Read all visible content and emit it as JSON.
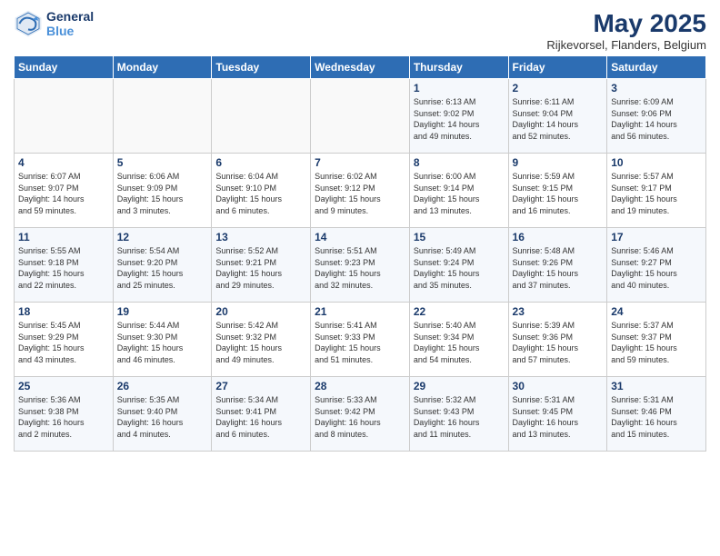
{
  "header": {
    "logo_line1": "General",
    "logo_line2": "Blue",
    "month_title": "May 2025",
    "subtitle": "Rijkevorsel, Flanders, Belgium"
  },
  "days_of_week": [
    "Sunday",
    "Monday",
    "Tuesday",
    "Wednesday",
    "Thursday",
    "Friday",
    "Saturday"
  ],
  "weeks": [
    [
      {
        "day": "",
        "info": ""
      },
      {
        "day": "",
        "info": ""
      },
      {
        "day": "",
        "info": ""
      },
      {
        "day": "",
        "info": ""
      },
      {
        "day": "1",
        "info": "Sunrise: 6:13 AM\nSunset: 9:02 PM\nDaylight: 14 hours\nand 49 minutes."
      },
      {
        "day": "2",
        "info": "Sunrise: 6:11 AM\nSunset: 9:04 PM\nDaylight: 14 hours\nand 52 minutes."
      },
      {
        "day": "3",
        "info": "Sunrise: 6:09 AM\nSunset: 9:06 PM\nDaylight: 14 hours\nand 56 minutes."
      }
    ],
    [
      {
        "day": "4",
        "info": "Sunrise: 6:07 AM\nSunset: 9:07 PM\nDaylight: 14 hours\nand 59 minutes."
      },
      {
        "day": "5",
        "info": "Sunrise: 6:06 AM\nSunset: 9:09 PM\nDaylight: 15 hours\nand 3 minutes."
      },
      {
        "day": "6",
        "info": "Sunrise: 6:04 AM\nSunset: 9:10 PM\nDaylight: 15 hours\nand 6 minutes."
      },
      {
        "day": "7",
        "info": "Sunrise: 6:02 AM\nSunset: 9:12 PM\nDaylight: 15 hours\nand 9 minutes."
      },
      {
        "day": "8",
        "info": "Sunrise: 6:00 AM\nSunset: 9:14 PM\nDaylight: 15 hours\nand 13 minutes."
      },
      {
        "day": "9",
        "info": "Sunrise: 5:59 AM\nSunset: 9:15 PM\nDaylight: 15 hours\nand 16 minutes."
      },
      {
        "day": "10",
        "info": "Sunrise: 5:57 AM\nSunset: 9:17 PM\nDaylight: 15 hours\nand 19 minutes."
      }
    ],
    [
      {
        "day": "11",
        "info": "Sunrise: 5:55 AM\nSunset: 9:18 PM\nDaylight: 15 hours\nand 22 minutes."
      },
      {
        "day": "12",
        "info": "Sunrise: 5:54 AM\nSunset: 9:20 PM\nDaylight: 15 hours\nand 25 minutes."
      },
      {
        "day": "13",
        "info": "Sunrise: 5:52 AM\nSunset: 9:21 PM\nDaylight: 15 hours\nand 29 minutes."
      },
      {
        "day": "14",
        "info": "Sunrise: 5:51 AM\nSunset: 9:23 PM\nDaylight: 15 hours\nand 32 minutes."
      },
      {
        "day": "15",
        "info": "Sunrise: 5:49 AM\nSunset: 9:24 PM\nDaylight: 15 hours\nand 35 minutes."
      },
      {
        "day": "16",
        "info": "Sunrise: 5:48 AM\nSunset: 9:26 PM\nDaylight: 15 hours\nand 37 minutes."
      },
      {
        "day": "17",
        "info": "Sunrise: 5:46 AM\nSunset: 9:27 PM\nDaylight: 15 hours\nand 40 minutes."
      }
    ],
    [
      {
        "day": "18",
        "info": "Sunrise: 5:45 AM\nSunset: 9:29 PM\nDaylight: 15 hours\nand 43 minutes."
      },
      {
        "day": "19",
        "info": "Sunrise: 5:44 AM\nSunset: 9:30 PM\nDaylight: 15 hours\nand 46 minutes."
      },
      {
        "day": "20",
        "info": "Sunrise: 5:42 AM\nSunset: 9:32 PM\nDaylight: 15 hours\nand 49 minutes."
      },
      {
        "day": "21",
        "info": "Sunrise: 5:41 AM\nSunset: 9:33 PM\nDaylight: 15 hours\nand 51 minutes."
      },
      {
        "day": "22",
        "info": "Sunrise: 5:40 AM\nSunset: 9:34 PM\nDaylight: 15 hours\nand 54 minutes."
      },
      {
        "day": "23",
        "info": "Sunrise: 5:39 AM\nSunset: 9:36 PM\nDaylight: 15 hours\nand 57 minutes."
      },
      {
        "day": "24",
        "info": "Sunrise: 5:37 AM\nSunset: 9:37 PM\nDaylight: 15 hours\nand 59 minutes."
      }
    ],
    [
      {
        "day": "25",
        "info": "Sunrise: 5:36 AM\nSunset: 9:38 PM\nDaylight: 16 hours\nand 2 minutes."
      },
      {
        "day": "26",
        "info": "Sunrise: 5:35 AM\nSunset: 9:40 PM\nDaylight: 16 hours\nand 4 minutes."
      },
      {
        "day": "27",
        "info": "Sunrise: 5:34 AM\nSunset: 9:41 PM\nDaylight: 16 hours\nand 6 minutes."
      },
      {
        "day": "28",
        "info": "Sunrise: 5:33 AM\nSunset: 9:42 PM\nDaylight: 16 hours\nand 8 minutes."
      },
      {
        "day": "29",
        "info": "Sunrise: 5:32 AM\nSunset: 9:43 PM\nDaylight: 16 hours\nand 11 minutes."
      },
      {
        "day": "30",
        "info": "Sunrise: 5:31 AM\nSunset: 9:45 PM\nDaylight: 16 hours\nand 13 minutes."
      },
      {
        "day": "31",
        "info": "Sunrise: 5:31 AM\nSunset: 9:46 PM\nDaylight: 16 hours\nand 15 minutes."
      }
    ]
  ]
}
